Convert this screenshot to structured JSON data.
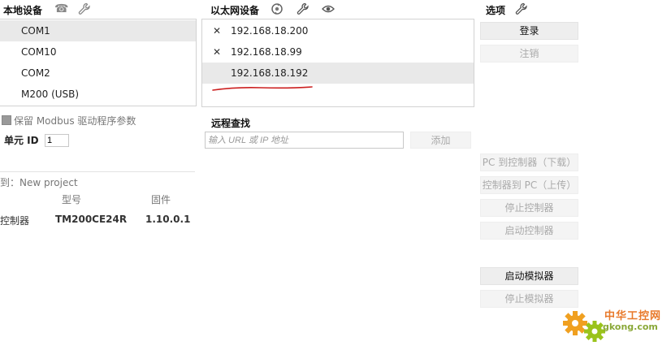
{
  "local": {
    "title": "本地设备",
    "devices": [
      "COM1",
      "COM10",
      "COM2",
      "M200 (USB)"
    ],
    "selected_index": 0,
    "keep_modbus_label": "保留 Modbus 驱动程序参数",
    "unit_id_label": "单元 ID",
    "unit_id_value": "1"
  },
  "connected": {
    "label": "到：New project",
    "col_model": "型号",
    "col_firmware": "固件",
    "row_name": "控制器",
    "row_model": "TM200CE24R",
    "row_firmware": "1.10.0.1"
  },
  "ethernet": {
    "title": "以太网设备",
    "devices": [
      {
        "mark": "✕",
        "ip": "192.168.18.200"
      },
      {
        "mark": "✕",
        "ip": "192.168.18.99"
      },
      {
        "mark": "",
        "ip": "192.168.18.192"
      }
    ],
    "selected_index": 2,
    "annotation_color": "#cc1f1f"
  },
  "remote": {
    "title": "远程查找",
    "placeholder": "输入 URL 或 IP 地址",
    "add_label": "添加"
  },
  "options": {
    "title": "选项",
    "login": "登录",
    "logout": "注销",
    "pc_to_controller": "PC 到控制器（下载）",
    "controller_to_pc": "控制器到 PC（上传）",
    "stop_controller": "停止控制器",
    "start_controller": "启动控制器",
    "start_simulator": "启动模拟器",
    "stop_simulator": "停止模拟器"
  },
  "watermark": {
    "brand": "中华工控网",
    "domain": "gkong.com"
  },
  "icons": {
    "phone": "phone-icon",
    "wrench": "wrench-icon",
    "refresh": "refresh-icon",
    "eye": "eye-icon"
  }
}
